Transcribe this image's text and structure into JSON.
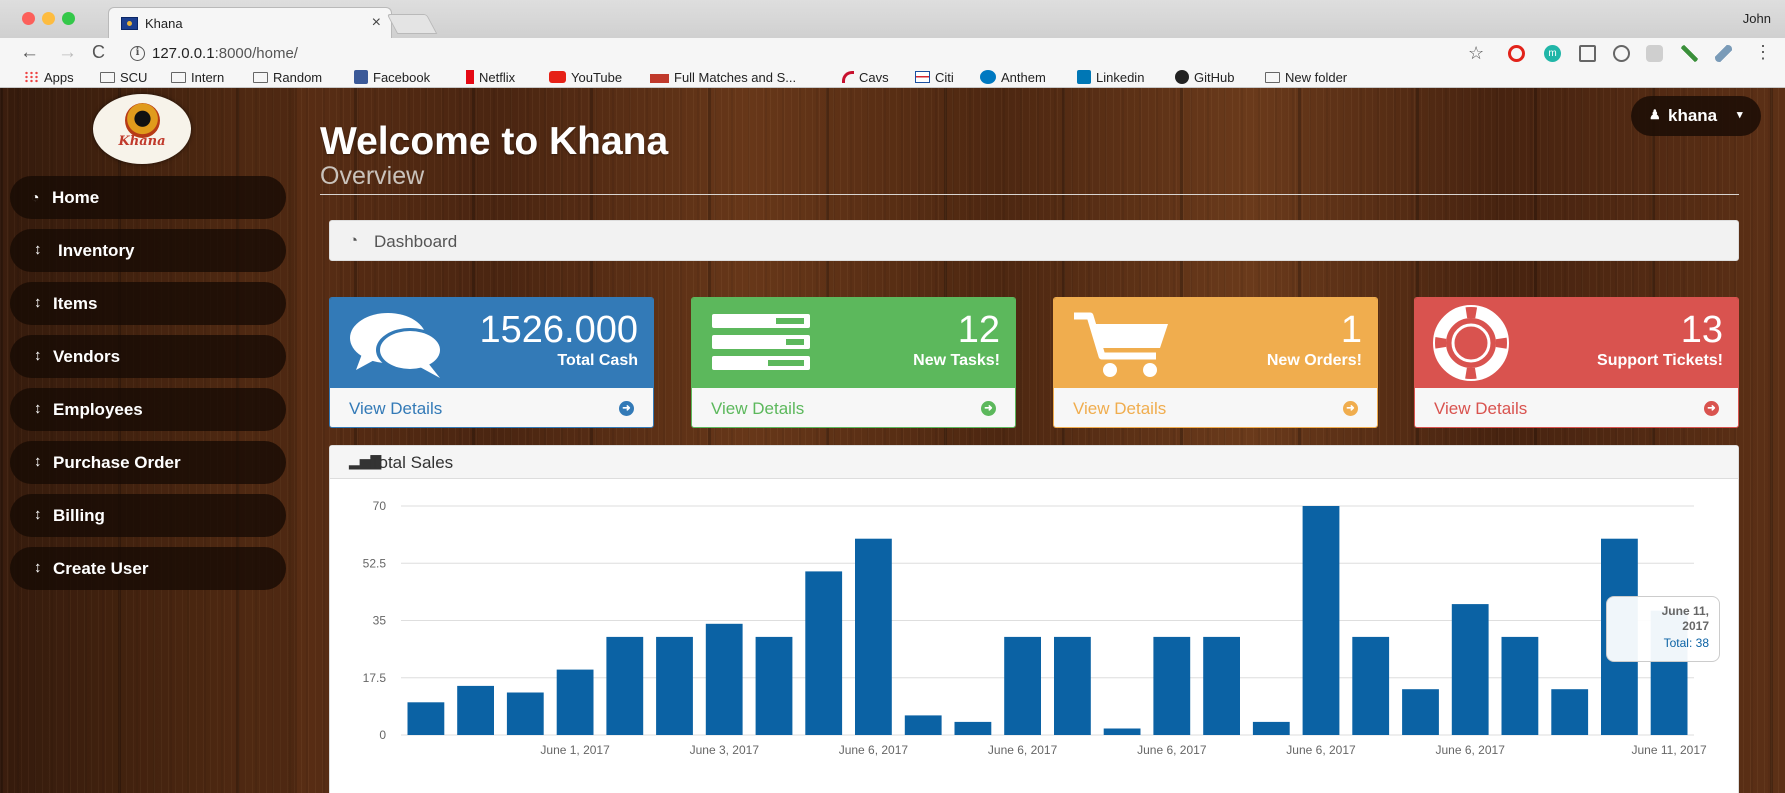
{
  "browser": {
    "tab_title": "Khana",
    "profile_name": "John",
    "url_host": "127.0.0.1",
    "url_path": ":8000/home/",
    "bookmarks": [
      "Apps",
      "SCU",
      "Intern",
      "Random",
      "Facebook",
      "Netflix",
      "YouTube",
      "Full Matches and S...",
      "Cavs",
      "Citi",
      "Anthem",
      "Linkedin",
      "GitHub",
      "New folder"
    ]
  },
  "sidebar": {
    "logo_text": "Khana",
    "items": [
      {
        "label": "Home",
        "icon": "tachometer-icon"
      },
      {
        "label": "Inventory",
        "icon": "sort-icon"
      },
      {
        "label": "Items",
        "icon": "sort-icon"
      },
      {
        "label": "Vendors",
        "icon": "sort-icon"
      },
      {
        "label": "Employees",
        "icon": "sort-icon"
      },
      {
        "label": "Purchase Order",
        "icon": "sort-icon"
      },
      {
        "label": "Billing",
        "icon": "sort-icon"
      },
      {
        "label": "Create User",
        "icon": "sort-icon"
      }
    ]
  },
  "header": {
    "title": "Welcome to Khana",
    "subtitle": "Overview",
    "user": "khana"
  },
  "dashboard": {
    "label": "Dashboard"
  },
  "cards": [
    {
      "value": "1526.000",
      "label": "Total Cash",
      "link": "View Details",
      "color": "#337ab7",
      "icon": "comments-icon"
    },
    {
      "value": "12",
      "label": "New Tasks!",
      "link": "View Details",
      "color": "#5cb85c",
      "icon": "tasks-icon"
    },
    {
      "value": "1",
      "label": "New Orders!",
      "link": "View Details",
      "color": "#f0ad4e",
      "icon": "shopping-cart-icon"
    },
    {
      "value": "13",
      "label": "Support Tickets!",
      "link": "View Details",
      "color": "#d9534f",
      "icon": "life-ring-icon"
    }
  ],
  "sales": {
    "title": "Total Sales",
    "tooltip": {
      "line1": "June 11,",
      "line2": "2017",
      "total": "Total: 38"
    }
  },
  "chart_data": {
    "type": "bar",
    "color": "#0b62a4",
    "y_ticks": [
      "70",
      "52.5",
      "35",
      "17.5",
      "0"
    ],
    "ylim": [
      0,
      70
    ],
    "x_tick_labels": [
      "June 1, 2017",
      "June 3, 2017",
      "June 6, 2017",
      "June 6, 2017",
      "June 6, 2017",
      "June 6, 2017",
      "June 6, 2017",
      "June 11, 2017"
    ],
    "series": [
      {
        "values": [
          10,
          15,
          13,
          20,
          30,
          30,
          34,
          30,
          50,
          60,
          6,
          4,
          30,
          30,
          2,
          30,
          30,
          4,
          70,
          30,
          14,
          40,
          30,
          14,
          60,
          38
        ]
      }
    ]
  }
}
